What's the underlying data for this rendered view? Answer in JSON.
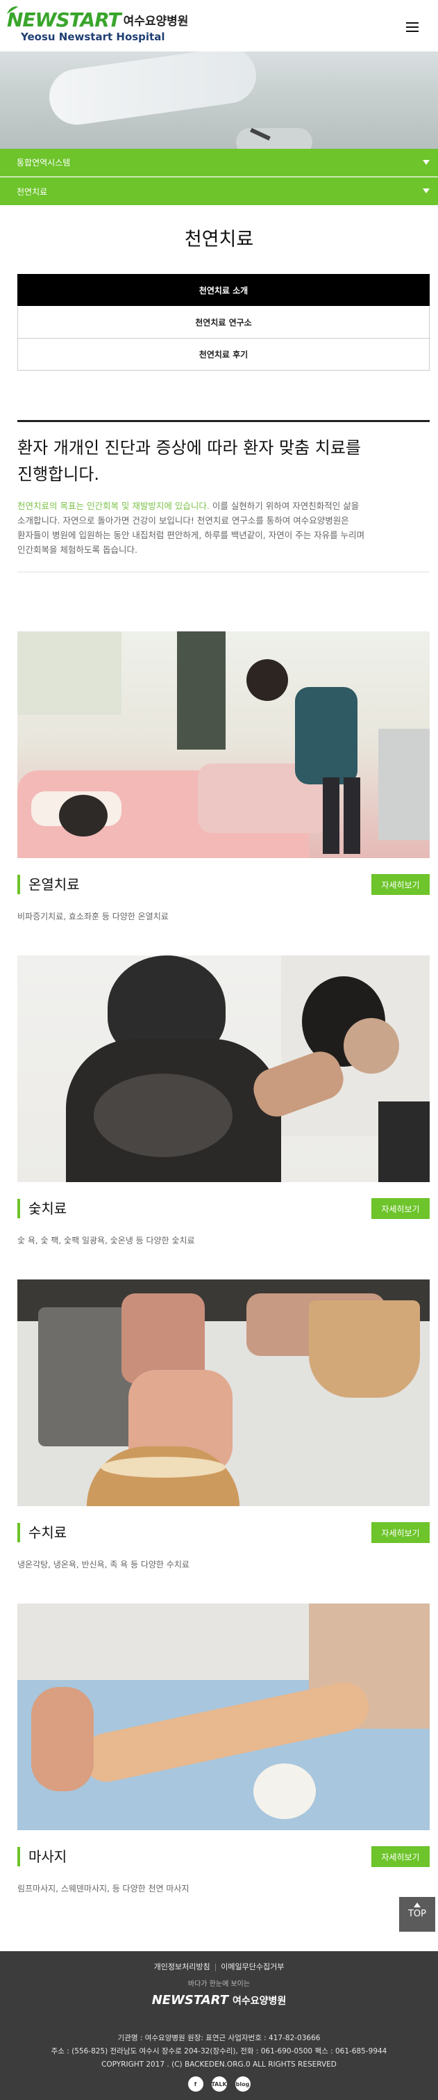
{
  "header": {
    "logo_en": "NEWSTART",
    "logo_ko": "여수요양병원",
    "logo_sub": "Yeosu Newstart Hospital",
    "menu_icon": "hamburger-menu-icon"
  },
  "nav": {
    "dropdown1": "통합연역시스템",
    "dropdown2": "천연치료"
  },
  "page": {
    "title": "천연치료",
    "tabs": [
      "천연치료 소개",
      "천연치료 연구소",
      "천연치료 후기"
    ]
  },
  "intro": {
    "headline_line1": "환자 개개인 진단과 증상에 따라 환자 맞춤 치료를",
    "headline_line2": "진행합니다.",
    "highlight": "천연치료의 목표는 인간회복 및 재발방지에 있습니다.",
    "text_line1_rest": " 이를 실현하기 위하여 자연친화적인 삶을",
    "text_line2": "소개합니다. 자연으로 돌아가면 건강이 보입니다! 천연치료 연구소를 통하여 여수요양병원은",
    "text_line3": "환자들이 병원에 입원하는 동안 내집처럼 편안하게, 하루를 백년같이, 자연이 주는 자유를 누리며",
    "text_line4": "인간회복을 체험하도록 돕습니다."
  },
  "therapies": [
    {
      "title": "온열치료",
      "button": "자세히보기",
      "desc": "비파증기치료, 효소좌훈 등 다양한 온열치료"
    },
    {
      "title": "숯치료",
      "button": "자세히보기",
      "desc": "숯 욕, 숯 팩, 숯팩 일광욕, 숯온냉 등 다양한 숯치료"
    },
    {
      "title": "수치료",
      "button": "자세히보기",
      "desc": "냉온각탕, 냉온욕, 반신욕, 족 욕 등 다양한 수치료"
    },
    {
      "title": "마사지",
      "button": "자세히보기",
      "desc": "림프마사지, 스웨덴마사지, 등 다양한 천연 마사지"
    }
  ],
  "top_button": "TOP",
  "footer": {
    "link1": "개인정보처리방침",
    "link2": "이메일무단수집거부",
    "slogan": "바다가 한눈에 보이는",
    "logo_en": "NEWSTART",
    "logo_ko": "여수요양병원",
    "info1": "기관명 : 여수요양병원 원장: 표연근 사업자번호 : 417-82-03666",
    "info2": "주소 : (556-825) 전라남도 여수시 장수로 204-32(장수리), 전화 : 061-690-0500 팩스 : 061-685-9944",
    "info3": "COPYRIGHT 2017 . (C) BACKEDEN.ORG.0 ALL RIGHTS RESERVED",
    "sns": [
      "f",
      "TALK",
      "blog"
    ]
  }
}
